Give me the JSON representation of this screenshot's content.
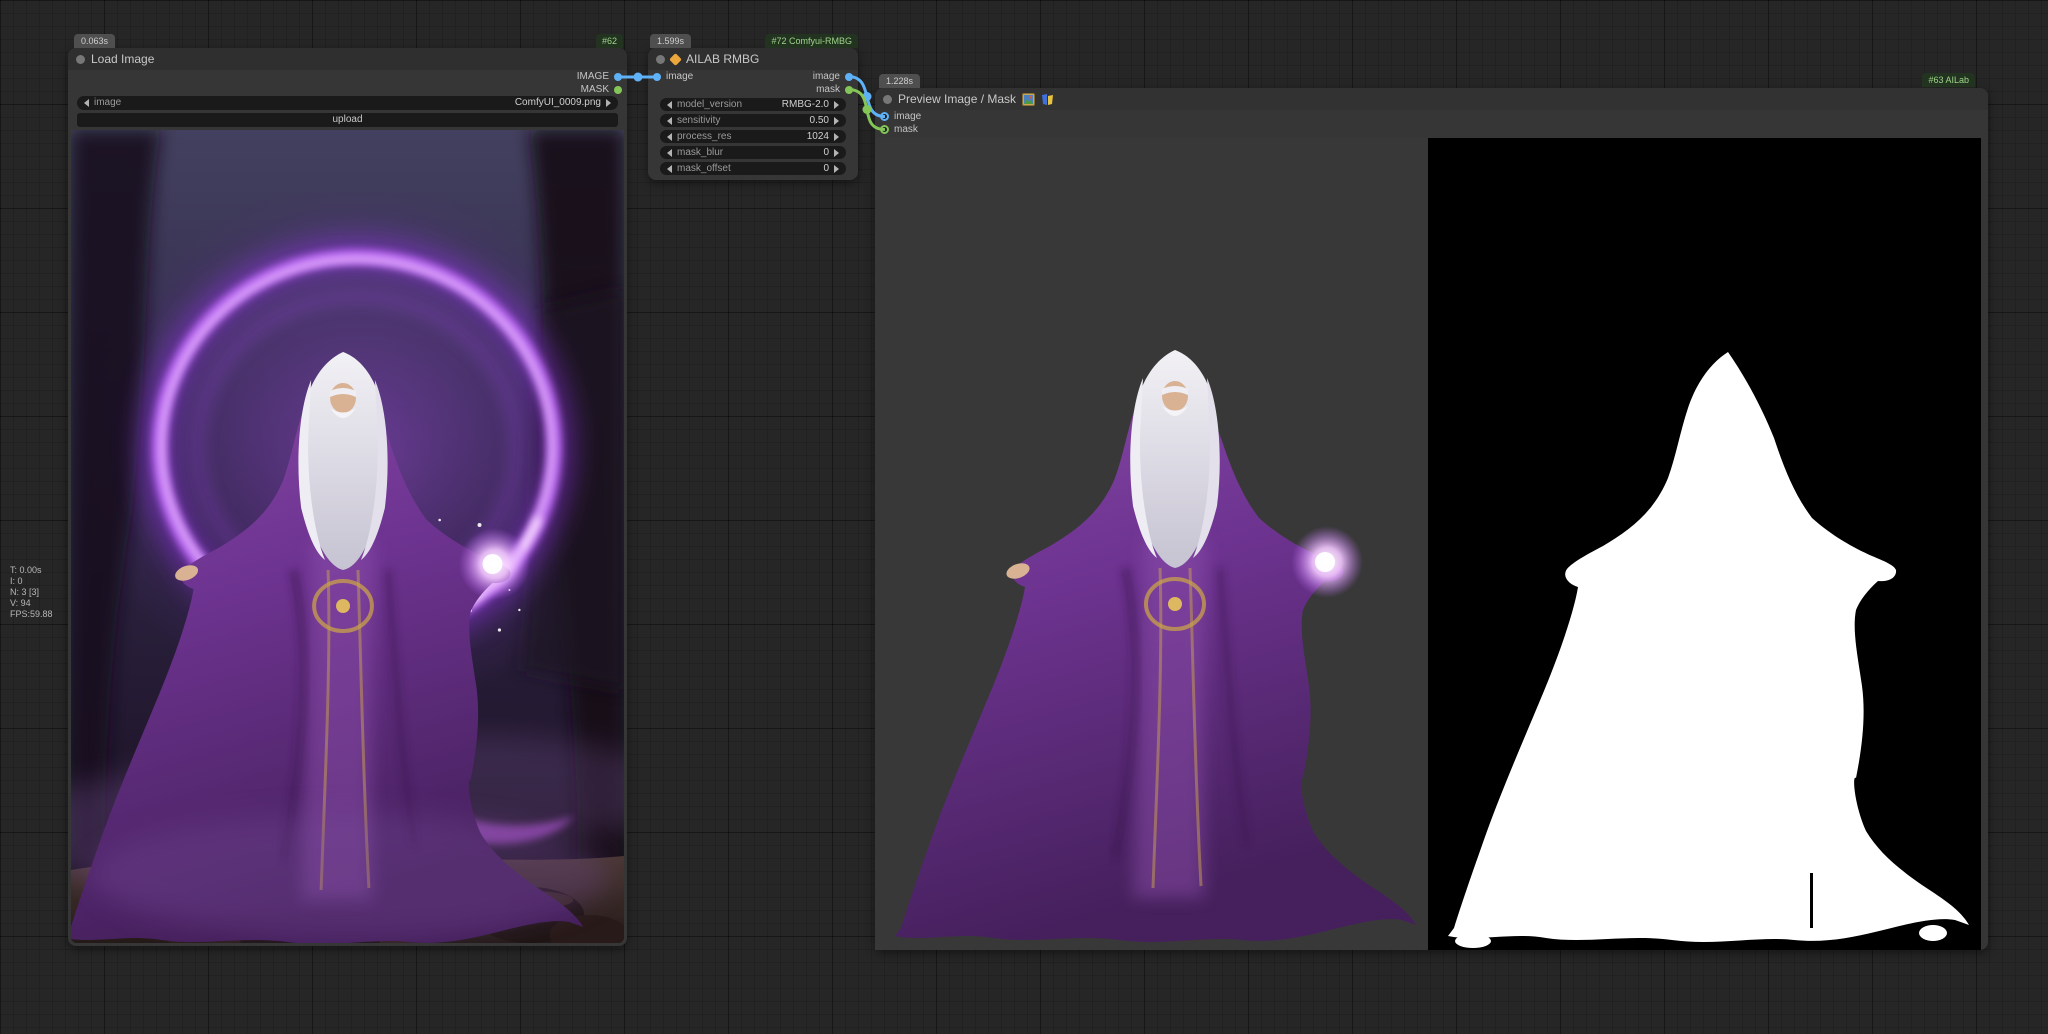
{
  "canvas": {
    "stats": {
      "time": "T: 0.00s",
      "iterations": "I: 0",
      "nodes": "N: 3 [3]",
      "version": "V: 94",
      "fps": "FPS:59.88"
    }
  },
  "nodes": {
    "load_image": {
      "timing_badge": "0.063s",
      "id_badge": "#62",
      "title": "Load Image",
      "outputs": {
        "image": "IMAGE",
        "mask": "MASK"
      },
      "image_widget": {
        "name": "image",
        "value": "ComfyUI_0009.png"
      },
      "upload_label": "upload"
    },
    "rmbg": {
      "timing_badge": "1.599s",
      "id_badge": "#72 Comfyui-RMBG",
      "title": "AILAB RMBG",
      "inputs": {
        "image": "image"
      },
      "outputs": {
        "image": "image",
        "mask": "mask"
      },
      "widgets": [
        {
          "name": "model_version",
          "value": "RMBG-2.0"
        },
        {
          "name": "sensitivity",
          "value": "0.50"
        },
        {
          "name": "process_res",
          "value": "1024"
        },
        {
          "name": "mask_blur",
          "value": "0"
        },
        {
          "name": "mask_offset",
          "value": "0"
        }
      ]
    },
    "preview": {
      "timing_badge": "1.228s",
      "id_badge": "#63 AILab",
      "title": "Preview Image / Mask",
      "inputs": {
        "image": "image",
        "mask": "mask"
      }
    }
  },
  "colors": {
    "image_link": "#5fb2f7",
    "mask_link": "#84c558",
    "node_bg": "#363636",
    "badge_green_text": "#9fd48a",
    "canvas_bg": "#262626"
  }
}
